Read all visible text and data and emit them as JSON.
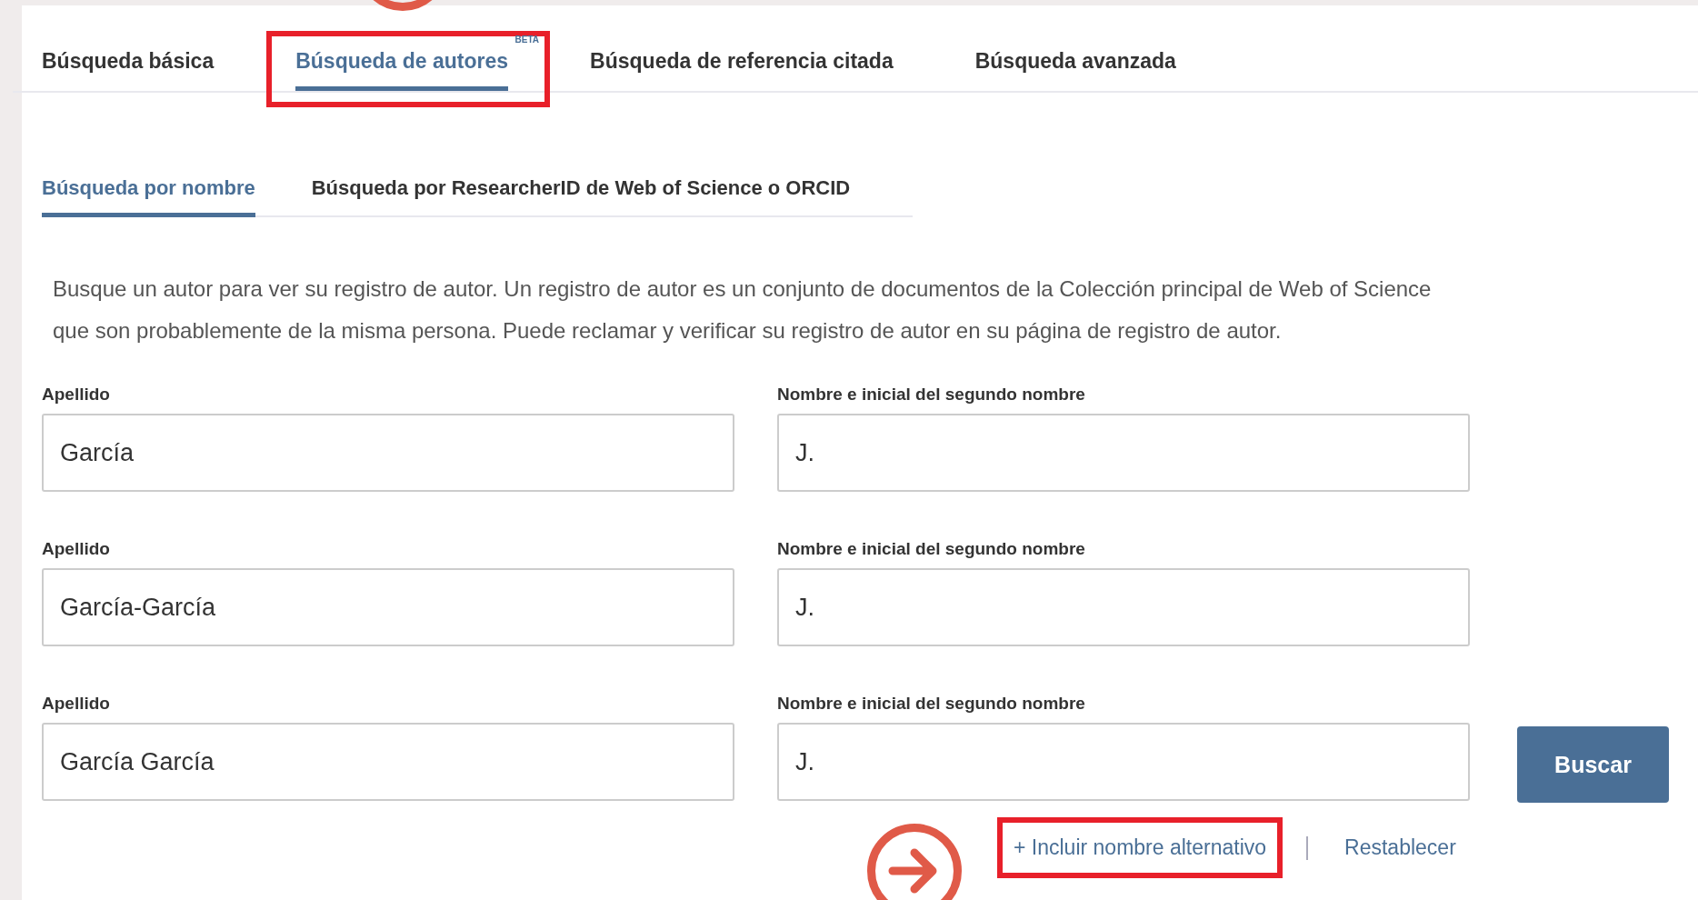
{
  "tabs": [
    {
      "label": "Búsqueda básica",
      "selected": false,
      "highlighted": false
    },
    {
      "label": "Búsqueda de autores",
      "selected": true,
      "highlighted": true,
      "badge": "BETA"
    },
    {
      "label": "Búsqueda de referencia citada",
      "selected": false,
      "highlighted": false
    },
    {
      "label": "Búsqueda avanzada",
      "selected": false,
      "highlighted": false
    }
  ],
  "subtabs": [
    {
      "label": "Búsqueda por nombre",
      "selected": true
    },
    {
      "label": "Búsqueda por ResearcherID de Web of Science o ORCID",
      "selected": false
    }
  ],
  "description": "Busque un autor para ver su registro de autor. Un registro de autor es un conjunto de documentos de la Colección principal de Web of Science que son probablemente de la misma persona. Puede reclamar y verificar su registro de autor en su página de registro de autor.",
  "rows": [
    {
      "surname": {
        "label": "Apellido",
        "value": "García"
      },
      "given": {
        "label": "Nombre e inicial del segundo nombre",
        "value": "J."
      }
    },
    {
      "surname": {
        "label": "Apellido",
        "value": "García-García"
      },
      "given": {
        "label": "Nombre e inicial del segundo nombre",
        "value": "J."
      }
    },
    {
      "surname": {
        "label": "Apellido",
        "value": "García García"
      },
      "given": {
        "label": "Nombre e inicial del segundo nombre",
        "value": "J."
      }
    }
  ],
  "search_button": "Buscar",
  "links": [
    {
      "label": "+ Incluir nombre alternativo",
      "highlighted": true
    },
    {
      "label": "Restablecer",
      "highlighted": false
    }
  ]
}
